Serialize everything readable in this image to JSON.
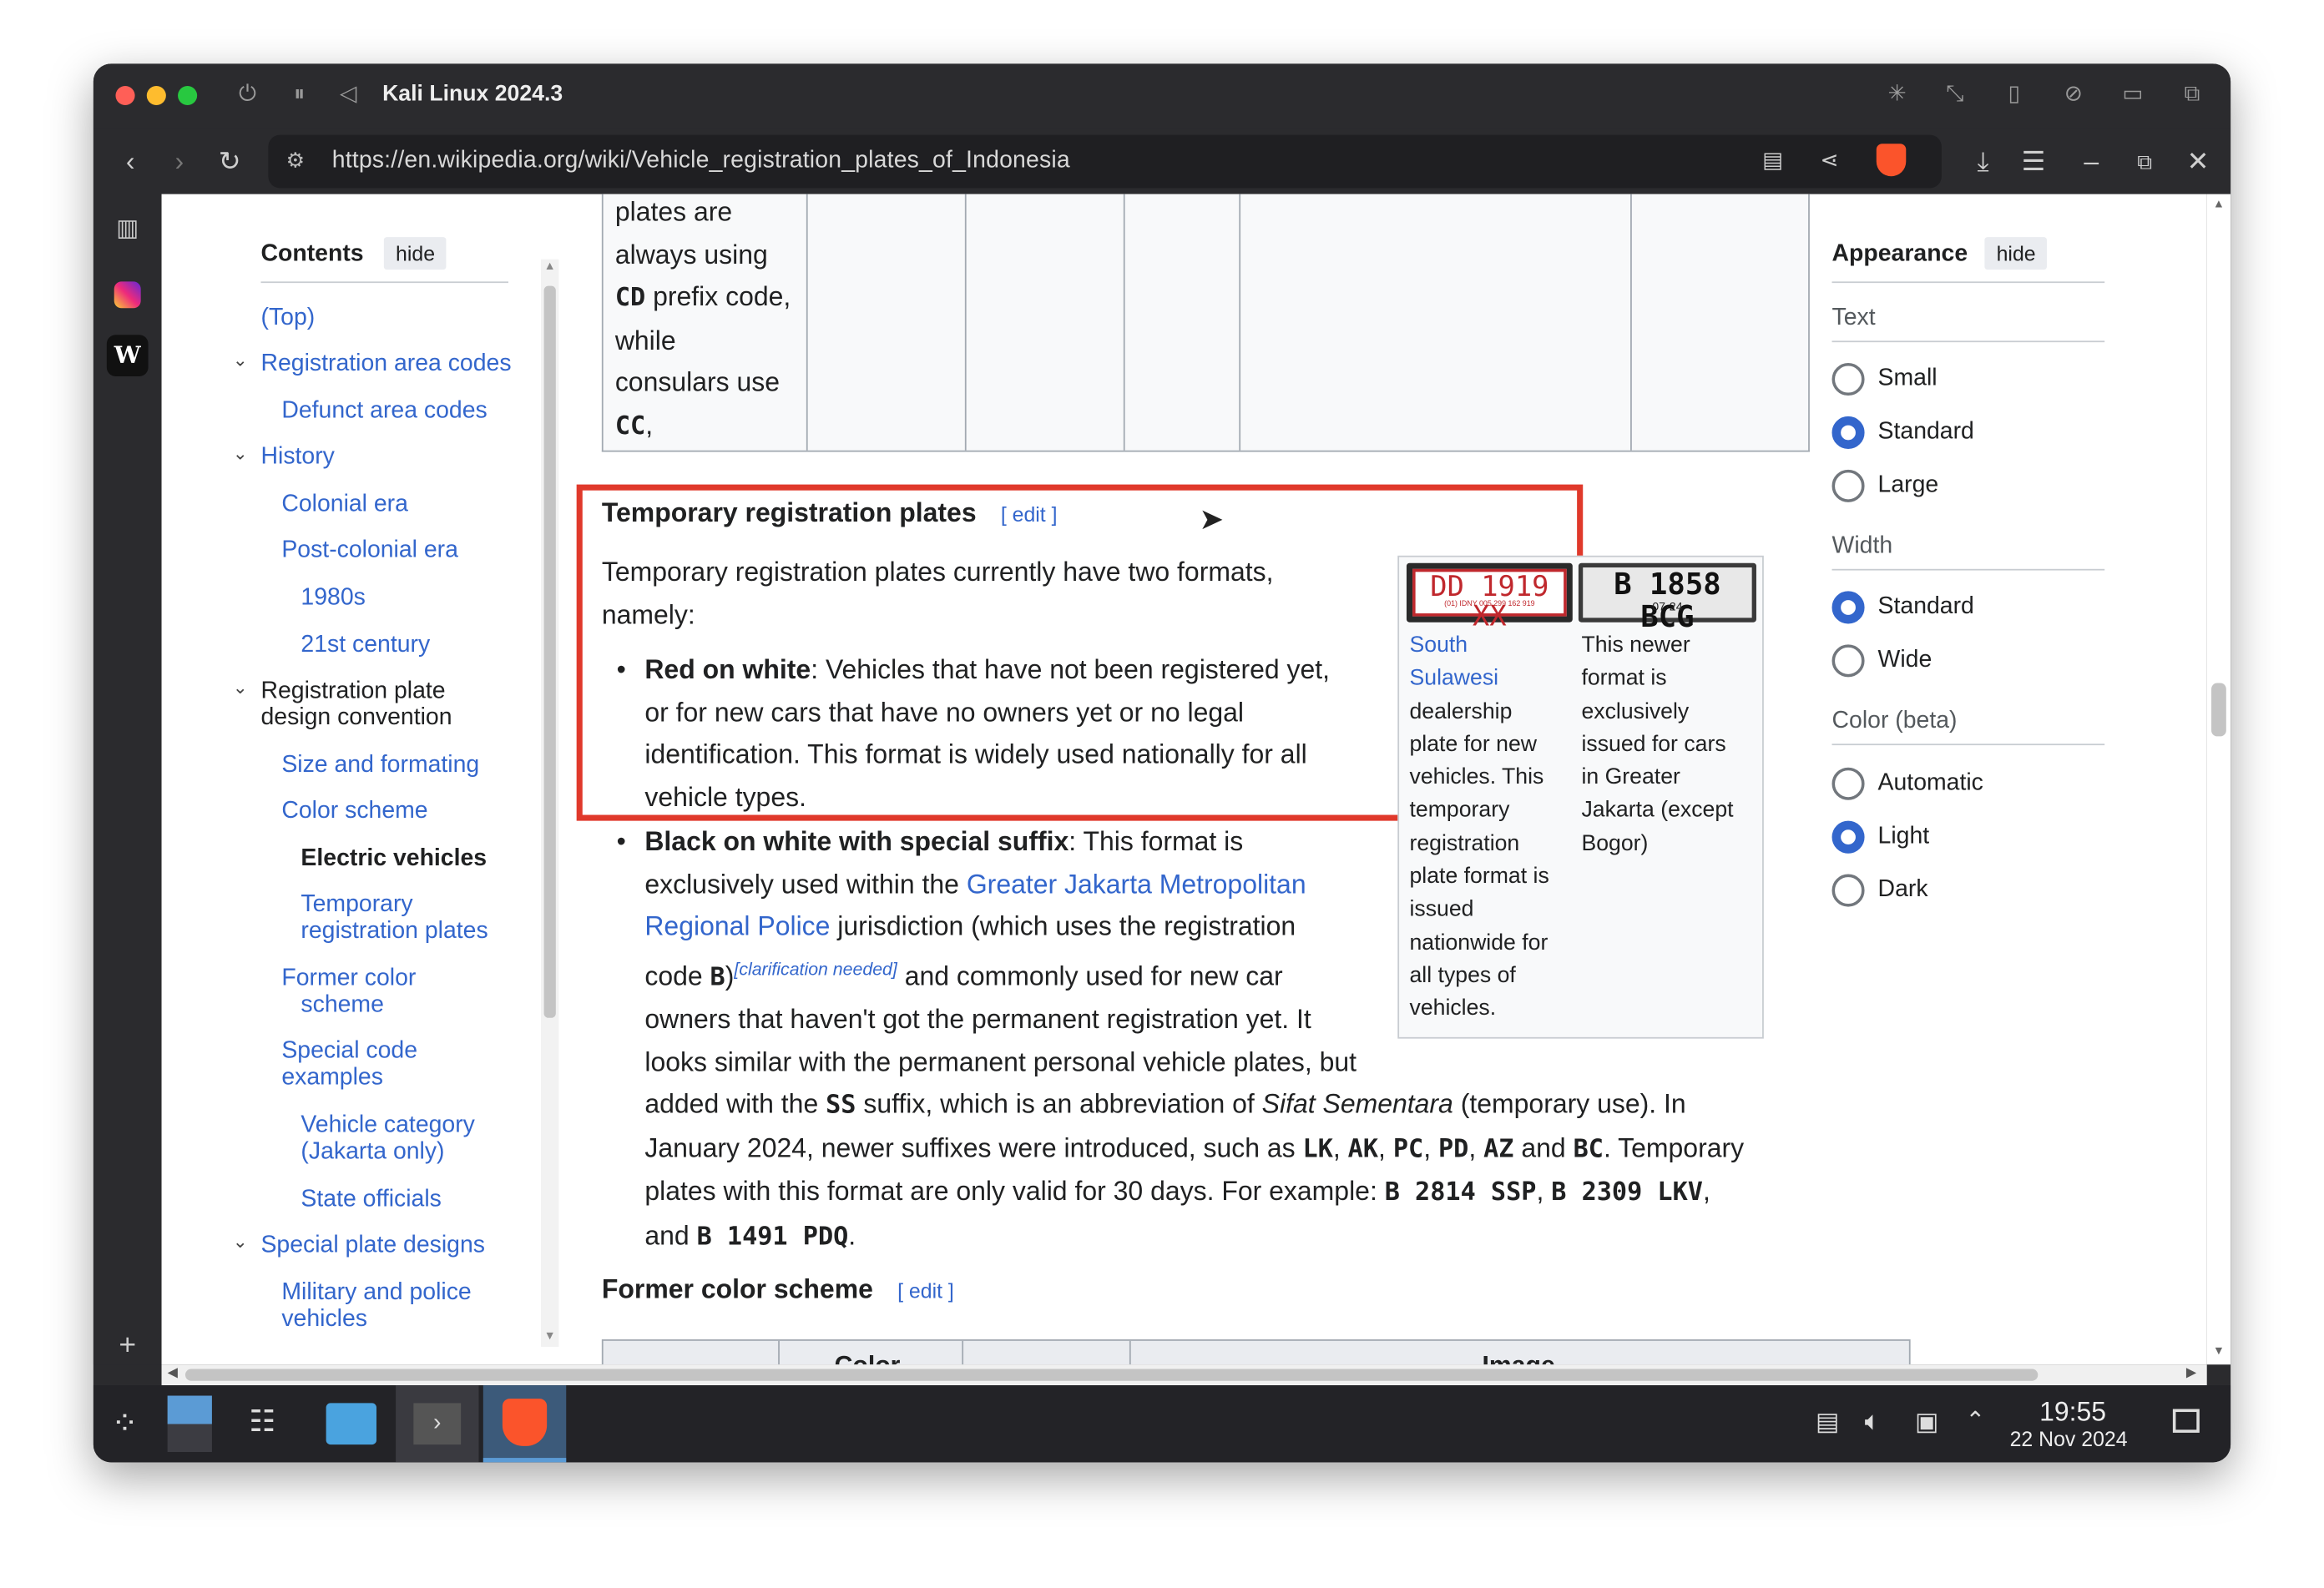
{
  "window": {
    "title": "Kali Linux 2024.3"
  },
  "browser": {
    "url": "https://en.wikipedia.org/wiki/Vehicle_registration_plates_of_Indonesia"
  },
  "toc": {
    "title": "Contents",
    "hide": "hide",
    "items": [
      {
        "label": "(Top)"
      },
      {
        "label": "Registration area codes"
      },
      {
        "label": "Defunct area codes"
      },
      {
        "label": "History"
      },
      {
        "label": "Colonial era"
      },
      {
        "label": "Post-colonial era"
      },
      {
        "label": "1980s"
      },
      {
        "label": "21st century"
      },
      {
        "label": "Registration plate"
      },
      {
        "label": "design convention"
      },
      {
        "label": "Size and formating"
      },
      {
        "label": "Color scheme"
      },
      {
        "label": "Electric vehicles"
      },
      {
        "label": "Temporary"
      },
      {
        "label": "registration plates"
      },
      {
        "label": "Former color"
      },
      {
        "label": "scheme"
      },
      {
        "label": "Special code"
      },
      {
        "label": "examples"
      },
      {
        "label": "Vehicle category"
      },
      {
        "label": "(Jakarta only)"
      },
      {
        "label": "State officials"
      },
      {
        "label": "Special plate designs"
      },
      {
        "label": "Military and police"
      },
      {
        "label": "vehicles"
      }
    ]
  },
  "table_top": {
    "l1": "plates are",
    "l2": "always using",
    "l3a": "CD",
    "l3b": " prefix code,",
    "l4": "while",
    "l5": "consulars use",
    "l6a": "CC",
    "l6b": ","
  },
  "section": {
    "heading": "Temporary registration plates",
    "edit": "[ edit ]",
    "intro1": "Temporary registration plates currently have two formats,",
    "intro2": "namely:",
    "b1_bold": "Red on white",
    "b1_l1": ": Vehicles that have not been registered yet,",
    "b1_l2": "or for new cars that have no owners yet or no legal",
    "b1_l3": "identification. This format is widely used nationally for all",
    "b1_l4": "vehicle types.",
    "b2_bold": "Black on white with special suffix",
    "b2_l1": ": This format is",
    "b2_l2a": "exclusively used within the ",
    "b2_link1": "Greater Jakarta Metropolitan",
    "b2_link2": "Regional Police",
    "b2_l3": " jurisdiction (which uses the registration",
    "b2_l4a": "code ",
    "b2_code": "B",
    "b2_l4b": ")",
    "b2_clar": "[clarification needed]",
    "b2_l4c": " and commonly used for new car",
    "b2_l5": "owners that haven't got the permanent registration yet. It",
    "b2_l6": "looks similar with the permanent personal vehicle plates, but",
    "b2_l7a": "added with the ",
    "b2_ss": "SS",
    "b2_l7b": " suffix, which is an abbreviation of ",
    "b2_ital": "Sifat Sementara",
    "b2_l7c": " (temporary use). In",
    "b2_l8a": "January 2024, newer suffixes were introduced, such as ",
    "s1": "LK",
    "s2": "AK",
    "s3": "PC",
    "s4": "PD",
    "s5": "AZ",
    "b2_and": " and ",
    "s6": "BC",
    "b2_l8b": ". Temporary",
    "b2_l9": "plates with this format are only valid for 30 days. For example: ",
    "ex1": "B 2814 SSP",
    "ex2": "B 2309 LKV",
    "b2_l10": "and ",
    "ex3": "B 1491 PDQ"
  },
  "images": {
    "plate1": "DD 1919 XX",
    "plate1_sub": "(01) IDNY 005 299 162 919",
    "plate2": "B 1858 BCG",
    "plate2_sub": "07·24",
    "cap1_link1": "South",
    "cap1_link2": "Sulawesi",
    "cap1": [
      "dealership",
      "plate for new",
      "vehicles. This",
      "temporary",
      "registration",
      "plate format is",
      "issued",
      "nationwide for",
      "all types of",
      "vehicles."
    ],
    "cap2": [
      "This newer",
      "format is",
      "exclusively",
      "issued for cars",
      "in Greater",
      "Jakarta (except",
      "Bogor)"
    ]
  },
  "section2": {
    "heading": "Former color scheme",
    "edit": "[ edit ]",
    "th1": "Color",
    "th2": "Image"
  },
  "appearance": {
    "title": "Appearance",
    "hide": "hide",
    "text_label": "Text",
    "text_opts": [
      "Small",
      "Standard",
      "Large"
    ],
    "text_selected": "Standard",
    "width_label": "Width",
    "width_opts": [
      "Standard",
      "Wide"
    ],
    "width_selected": "Standard",
    "color_label": "Color (beta)",
    "color_opts": [
      "Automatic",
      "Light",
      "Dark"
    ],
    "color_selected": "Light"
  },
  "taskbar": {
    "time": "19:55",
    "date": "22 Nov 2024"
  },
  "colors": {
    "highlight": "#e0392b",
    "link": "#3366cc"
  }
}
